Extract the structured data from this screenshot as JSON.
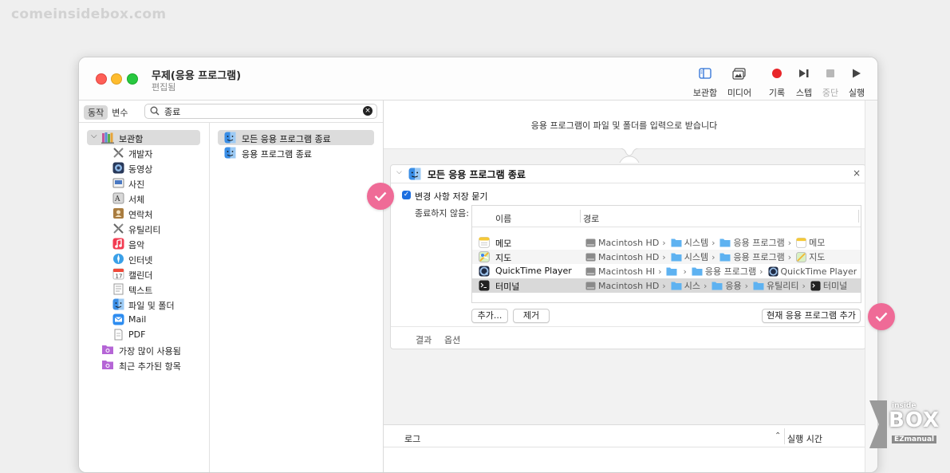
{
  "watermark": "comeinsidebox.com",
  "window": {
    "title": "무제(응용 프로그램)",
    "subtitle": "편집됨"
  },
  "toolbar": {
    "library": "보관함",
    "media": "미디어",
    "record": "기록",
    "step": "스텝",
    "stop": "중단",
    "run": "실행"
  },
  "leftpane": {
    "tab_actions": "동작",
    "tab_variables": "변수",
    "search_value": "종료",
    "library_root": "보관함",
    "library_items": [
      "개발자",
      "동영상",
      "사진",
      "서체",
      "연락처",
      "유틸리티",
      "음악",
      "인터넷",
      "캘린더",
      "텍스트",
      "파일 및 폴더",
      "Mail",
      "PDF"
    ],
    "smart_groups": [
      "가장 많이 사용됨",
      "최근 추가된 항목"
    ],
    "actions": [
      "모든 응용 프로그램 종료",
      "응용 프로그램 종료"
    ]
  },
  "workflow": {
    "input_note": "응용 프로그램이 파일 및 폴더를 입력으로 받습니다",
    "action_title": "모든 응용 프로그램 종료",
    "ask_save_label": "변경 사항 저장 묻기",
    "dont_quit_label": "종료하지 않음:",
    "col_name": "이름",
    "col_path": "경로",
    "rows": [
      {
        "name": "메모",
        "path": [
          "Macintosh HD",
          "시스템",
          "응용 프로그램",
          "메모"
        ]
      },
      {
        "name": "지도",
        "path": [
          "Macintosh HD",
          "시스템",
          "응용 프로그램",
          "지도"
        ]
      },
      {
        "name": "QuickTime Player",
        "path": [
          "Macintosh HI",
          "",
          "응용 프로그램",
          "QuickTime Player"
        ]
      },
      {
        "name": "터미널",
        "path": [
          "Macintosh HD",
          "시스",
          "응용",
          "유틸리티",
          "터미널"
        ]
      }
    ],
    "add_button": "추가...",
    "remove_button": "제거",
    "add_current_button": "현재 응용 프로그램 추가",
    "footer_results": "결과",
    "footer_options": "옵션"
  },
  "log": {
    "log_header": "로그",
    "duration_header": "실행 시간"
  },
  "logo": {
    "top": "inside",
    "main": "BOX",
    "bottom": "EZmanual"
  }
}
